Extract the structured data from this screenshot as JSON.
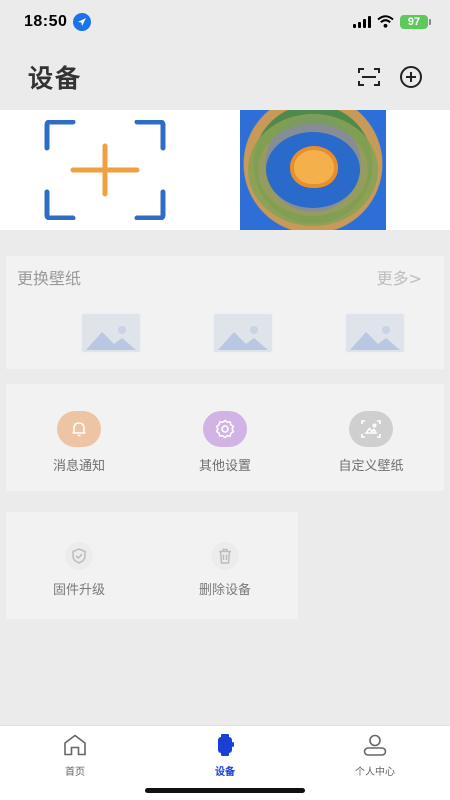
{
  "status_bar": {
    "time": "18:50",
    "battery": "97",
    "icons": [
      "location-arrow-icon",
      "cellular-signal-icon",
      "wifi-icon",
      "battery-icon"
    ]
  },
  "header": {
    "title": "设备",
    "icons": [
      "scan-icon",
      "add-circle-icon"
    ]
  },
  "devices": {
    "icons": [
      "add-device-icon",
      "device-wallpaper-image"
    ],
    "colors": {
      "frame": "#2a6acb",
      "plus": "#f0a040"
    }
  },
  "wallpaper": {
    "title": "更换壁纸",
    "more": "更多>",
    "thumbnails": [
      "image-placeholder-icon",
      "image-placeholder-icon",
      "image-placeholder-icon"
    ]
  },
  "settings": {
    "items": [
      {
        "label": "消息通知",
        "icon": "bell-icon",
        "color": "#eec5a4"
      },
      {
        "label": "其他设置",
        "icon": "gear-icon",
        "color": "#d2b3e6"
      },
      {
        "label": "自定义壁纸",
        "icon": "custom-wallpaper-icon",
        "color": "#cfcfcf"
      }
    ]
  },
  "device_actions": {
    "items": [
      {
        "label": "固件升级",
        "icon": "shield-check-icon"
      },
      {
        "label": "删除设备",
        "icon": "trash-icon"
      }
    ]
  },
  "tab_bar": {
    "tabs": [
      {
        "label": "首页",
        "icon": "home-icon"
      },
      {
        "label": "设备",
        "icon": "watch-icon",
        "active": true
      },
      {
        "label": "个人中心",
        "icon": "person-icon"
      }
    ],
    "active_color": "#1a3fd6"
  }
}
